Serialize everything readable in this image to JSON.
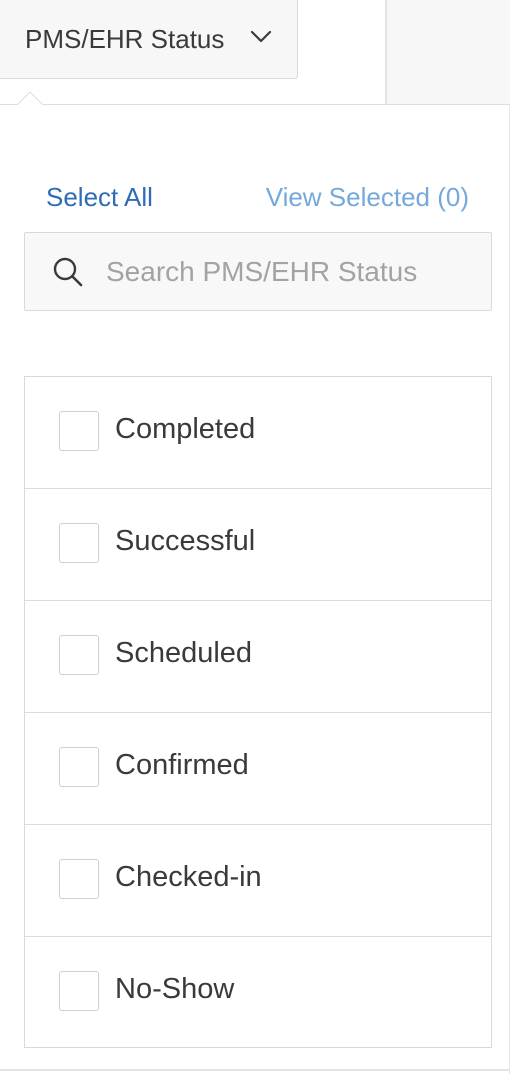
{
  "filter": {
    "trigger_label": "PMS/EHR Status",
    "trigger_icon": "chevron-down-icon"
  },
  "dropdown": {
    "select_all": "Select All",
    "view_selected": "View Selected (0)",
    "search": {
      "placeholder": "Search PMS/EHR Status",
      "value": "",
      "icon": "search-icon"
    },
    "options": [
      {
        "label": "Completed",
        "checked": false
      },
      {
        "label": "Successful",
        "checked": false
      },
      {
        "label": "Scheduled",
        "checked": false
      },
      {
        "label": "Confirmed",
        "checked": false
      },
      {
        "label": "Checked-in",
        "checked": false
      },
      {
        "label": "No-Show",
        "checked": false
      }
    ]
  },
  "colors": {
    "link_primary": "#2e6db5",
    "link_secondary": "#74a9dc",
    "text": "#3a3a3a",
    "border": "#d9d9d9"
  }
}
